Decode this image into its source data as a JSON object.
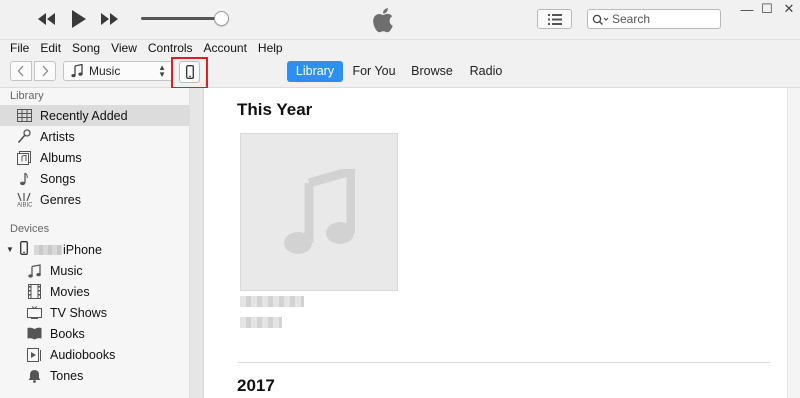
{
  "titlebar": {
    "search_placeholder": "Search",
    "window_controls": {
      "minimize": "—",
      "maximize": "☐",
      "close": "✕"
    }
  },
  "menu": [
    "File",
    "Edit",
    "Song",
    "View",
    "Controls",
    "Account",
    "Help"
  ],
  "navbar": {
    "media_type": "Music",
    "tabs": [
      {
        "label": "Library",
        "active": true
      },
      {
        "label": "For You",
        "active": false
      },
      {
        "label": "Browse",
        "active": false
      },
      {
        "label": "Radio",
        "active": false
      }
    ]
  },
  "sidebar": {
    "library_heading": "Library",
    "library_items": [
      {
        "label": "Recently Added",
        "icon": "grid-icon",
        "selected": true
      },
      {
        "label": "Artists",
        "icon": "microphone-icon",
        "selected": false
      },
      {
        "label": "Albums",
        "icon": "album-icon",
        "selected": false
      },
      {
        "label": "Songs",
        "icon": "music-note-icon",
        "selected": false
      },
      {
        "label": "Genres",
        "icon": "genres-icon",
        "selected": false
      }
    ],
    "devices_heading": "Devices",
    "device_name": "iPhone",
    "device_items": [
      {
        "label": "Music",
        "icon": "music-note-icon"
      },
      {
        "label": "Movies",
        "icon": "film-icon"
      },
      {
        "label": "TV Shows",
        "icon": "tv-icon"
      },
      {
        "label": "Books",
        "icon": "book-icon"
      },
      {
        "label": "Audiobooks",
        "icon": "audiobook-icon"
      },
      {
        "label": "Tones",
        "icon": "bell-icon"
      }
    ]
  },
  "main": {
    "sections": [
      {
        "title": "This Year"
      },
      {
        "title": "2017"
      }
    ]
  },
  "colors": {
    "accent": "#2d8ff0",
    "highlight_box": "#e01e1e"
  }
}
